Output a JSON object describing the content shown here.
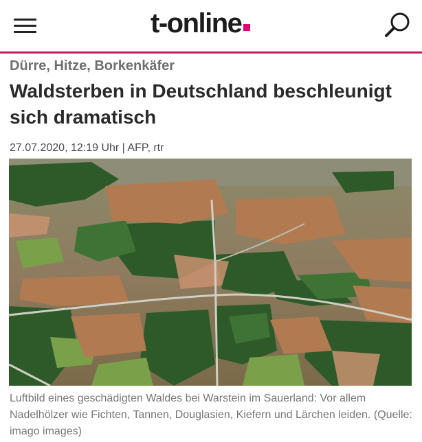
{
  "header": {
    "logo_text": "t-online",
    "logo_dot_color": "#e20074",
    "accent_color": "#c2185b",
    "menu_icon": "hamburger-menu-icon",
    "search_icon": "magnifier-search-icon"
  },
  "article": {
    "kicker": "Dürre, Hitze, Borkenkäfer",
    "headline": "Waldsterben in Deutschland beschleunigt sich dramatisch",
    "meta": "27.07.2020, 12:19 Uhr | AFP, rtr",
    "image_caption": "Luftbild eines geschädigten Waldes bei Warstein im Sauerland: Vor allem Nadelhölzer wie Fichten, Tannen, Douglasien, Kiefern und Lärchen leiden. (Quelle: imago images)"
  }
}
